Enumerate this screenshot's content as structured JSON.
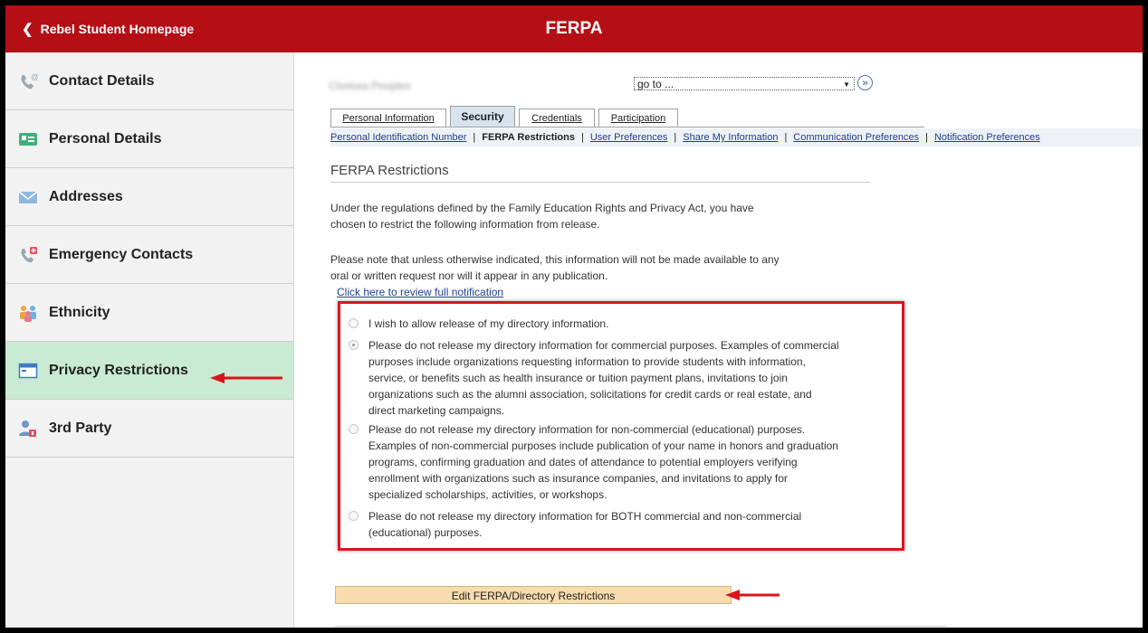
{
  "header": {
    "back_label": "Rebel Student Homepage",
    "title": "FERPA",
    "color": "#b40f15"
  },
  "sidebar": {
    "items": [
      {
        "label": "Contact Details",
        "icon": "phone-icon",
        "active": false
      },
      {
        "label": "Personal Details",
        "icon": "id-card-icon",
        "active": false
      },
      {
        "label": "Addresses",
        "icon": "envelope-icon",
        "active": false
      },
      {
        "label": "Emergency Contacts",
        "icon": "emergency-phone-icon",
        "active": false
      },
      {
        "label": "Ethnicity",
        "icon": "people-icon",
        "active": false
      },
      {
        "label": "Privacy Restrictions",
        "icon": "window-icon",
        "active": true
      },
      {
        "label": "3rd Party",
        "icon": "user-lock-icon",
        "active": false
      }
    ]
  },
  "content": {
    "student_name": "Chelsea Peoples",
    "goto": {
      "value": "go to ..."
    },
    "tabs": [
      {
        "label": "Personal Information",
        "selected": false
      },
      {
        "label": "Security",
        "selected": true
      },
      {
        "label": "Credentials",
        "selected": false
      },
      {
        "label": "Participation",
        "selected": false
      }
    ],
    "subnav": [
      {
        "label": "Personal Identification Number",
        "current": false
      },
      {
        "label": "FERPA Restrictions",
        "current": true
      },
      {
        "label": "User Preferences",
        "current": false
      },
      {
        "label": "Share My Information",
        "current": false
      },
      {
        "label": "Communication Preferences",
        "current": false
      },
      {
        "label": "Notification Preferences",
        "current": false
      }
    ],
    "section_title": "FERPA Restrictions",
    "paragraph1": [
      "Under the regulations defined by the Family Education Rights and Privacy Act, you have",
      "chosen to restrict the following information from release."
    ],
    "paragraph2": [
      "Please note that unless otherwise indicated, this information will not be made available to any",
      "oral or written request nor will it appear in any publication."
    ],
    "review_link": "Click here to review full notification",
    "options": [
      {
        "checked": false,
        "lines": [
          "I wish to allow release of my directory information."
        ]
      },
      {
        "checked": true,
        "lines": [
          "Please do not release my directory information for commercial purposes. Examples of commercial",
          "purposes include organizations requesting information to provide students with information,",
          "service, or benefits such as health insurance or tuition payment plans, invitations to join",
          "organizations such as the alumni association, solicitations for credit cards or real estate, and",
          "direct marketing campaigns."
        ]
      },
      {
        "checked": false,
        "lines": [
          "Please do not release my directory information for non-commercial (educational) purposes.",
          "Examples of non-commercial purposes include publication of your name in honors and graduation",
          "programs, confirming graduation and dates of attendance to potential employers verifying",
          "enrollment with organizations such as insurance companies, and invitations to apply for",
          "specialized scholarships, activities, or workshops."
        ]
      },
      {
        "checked": false,
        "lines": [
          "Please do not release my directory information for BOTH commercial and non-commercial",
          "(educational) purposes."
        ]
      }
    ],
    "edit_button": "Edit FERPA/Directory Restrictions"
  },
  "colors": {
    "highlight_border": "#d9151d",
    "active_sidebar": "#c9ead3",
    "button_bg": "#f8dcad",
    "link": "#1f3f8f"
  }
}
